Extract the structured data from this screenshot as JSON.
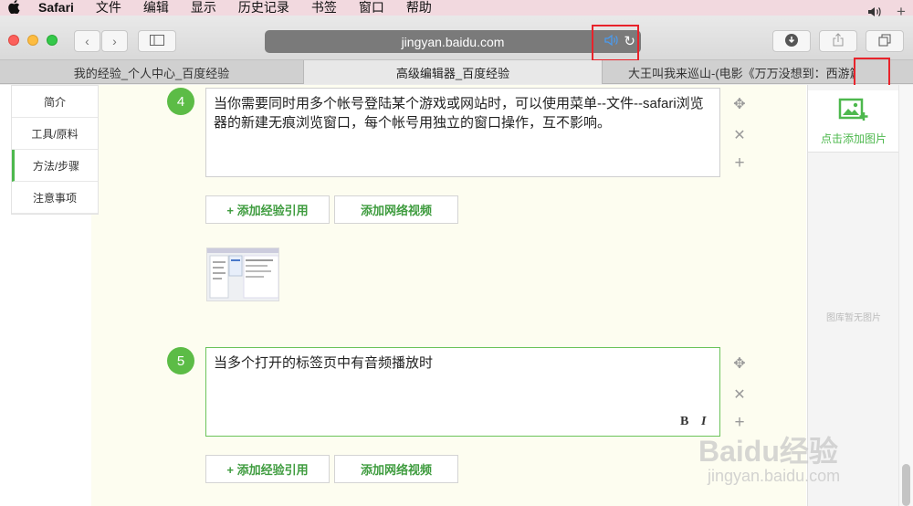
{
  "menubar": {
    "apple_icon": "apple-logo-icon",
    "items": [
      "Safari",
      "文件",
      "编辑",
      "显示",
      "历史记录",
      "书签",
      "窗口",
      "帮助"
    ]
  },
  "toolbar": {
    "url": "jingyan.baidu.com",
    "back_icon": "chevron-left-icon",
    "forward_icon": "chevron-right-icon",
    "sidebar_icon": "sidebar-icon",
    "speaker_icon": "speaker-icon",
    "reload_icon": "reload-icon",
    "download_icon": "download-icon",
    "share_icon": "share-icon",
    "tabs_icon": "tabs-overview-icon"
  },
  "tabs": [
    {
      "label": "我的经验_个人中心_百度经验",
      "active": false
    },
    {
      "label": "高级编辑器_百度经验",
      "active": true
    },
    {
      "label": "大王叫我来巡山-(电影《万万没想到：西游篇...",
      "active": false
    }
  ],
  "sidenav": {
    "items": [
      {
        "label": "简介",
        "active": false
      },
      {
        "label": "工具/原料",
        "active": false
      },
      {
        "label": "方法/步骤",
        "active": true
      },
      {
        "label": "注意事项",
        "active": false
      }
    ]
  },
  "steps": [
    {
      "number": "4",
      "text": "当你需要同时用多个帐号登陆某个游戏或网站时，可以使用菜单--文件--safari浏览器的新建无痕浏览窗口，每个帐号用独立的窗口操作，互不影响。"
    },
    {
      "number": "5",
      "text": "当多个打开的标签页中有音频播放时"
    }
  ],
  "buttons": {
    "add_reference": "+ 添加经验引用",
    "add_video": "添加网络视频",
    "bold": "B",
    "italic": "I"
  },
  "controls": {
    "move_icon": "move-icon",
    "delete_icon": "close-icon",
    "add_icon": "plus-icon"
  },
  "rightpanel": {
    "add_image_label": "点击添加图片",
    "empty_text": "图库暂无图片"
  },
  "watermark": {
    "logo": "Baidu经验",
    "url": "jingyan.baidu.com"
  },
  "colors": {
    "accent_green": "#5cbc46",
    "highlight_red": "#e8232b",
    "speaker_blue": "#4a9bf0"
  }
}
